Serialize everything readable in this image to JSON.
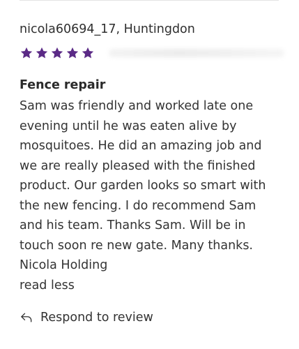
{
  "review": {
    "reviewer": "nicola60694_17, Huntingdon",
    "rating": 5,
    "rating_max": 5,
    "star_color": "#5b2a86",
    "job_title": "Fence repair",
    "body": "Sam was friendly and worked late one\nevening until he was eaten alive by\nmosquitoes. He did an amazing job and\nwe are really pleased with the finished\nproduct. Our garden looks so smart with\nthe new fencing. I do recommend Sam\nand his team. Thanks Sam. Will be in\ntouch soon re new gate. Many thanks.\nNicola Holding",
    "read_less_label": "read less"
  },
  "actions": {
    "respond_icon": "reply-arrow-icon",
    "respond_label": "Respond to review"
  }
}
